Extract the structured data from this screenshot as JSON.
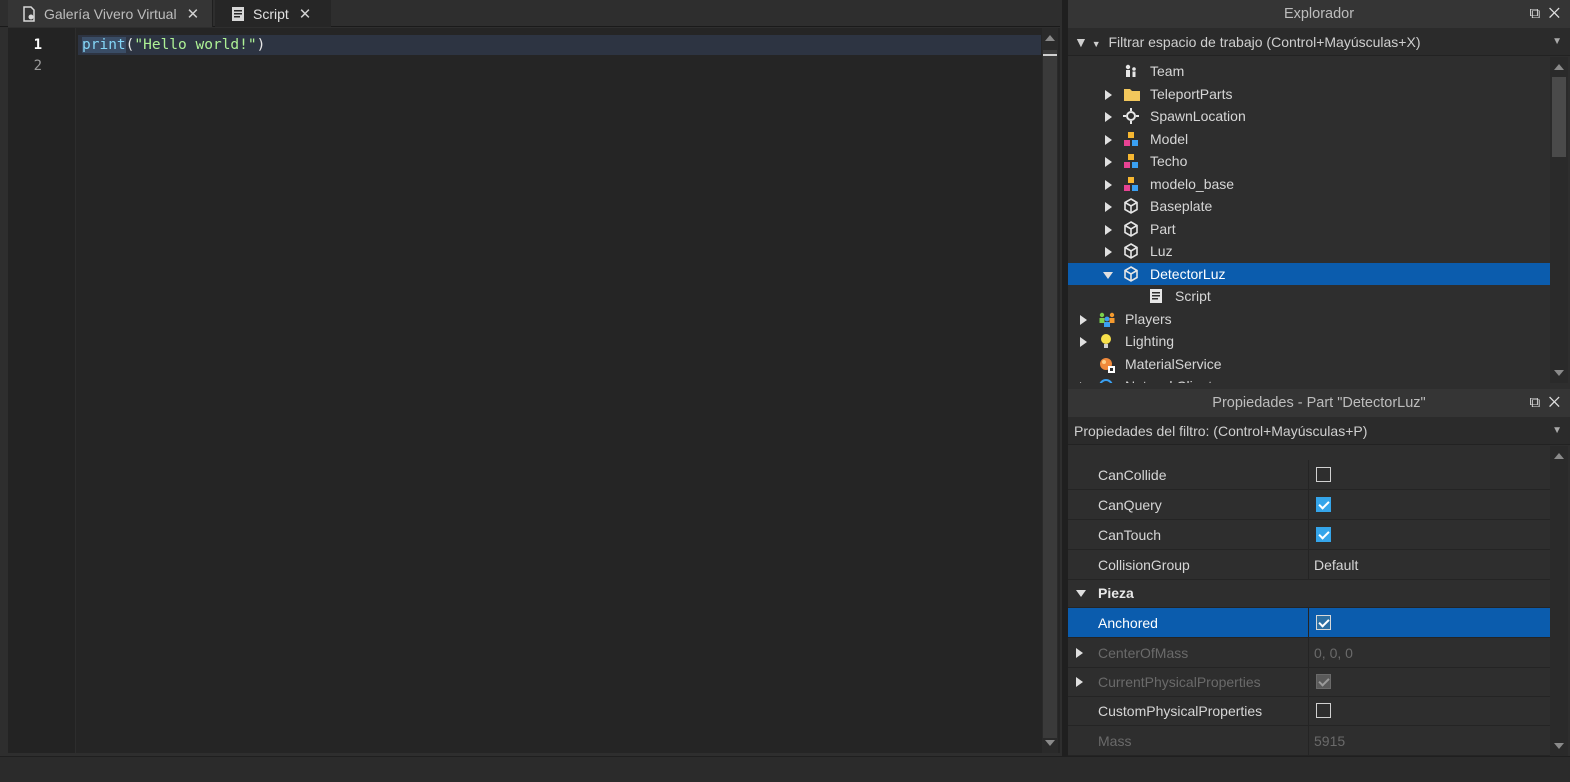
{
  "tabs": [
    {
      "label": "Galería Vivero Virtual",
      "icon": "script-tab-icon"
    },
    {
      "label": "Script",
      "icon": "script-icon"
    }
  ],
  "editor": {
    "line_numbers": [
      "1",
      "2"
    ],
    "code": {
      "fn": "print",
      "open": "(",
      "string": "\"Hello world!\"",
      "close": ")"
    }
  },
  "explorer": {
    "title": "Explorador",
    "filter_placeholder": "Filtrar espacio de trabajo (Control+Mayúsculas+X)",
    "items": [
      {
        "label": "Team",
        "icon": "team-icon",
        "expandable": false
      },
      {
        "label": "TeleportParts",
        "icon": "folder-icon",
        "expandable": true
      },
      {
        "label": "SpawnLocation",
        "icon": "spawn-icon",
        "expandable": true
      },
      {
        "label": "Model",
        "icon": "model-icon",
        "expandable": true
      },
      {
        "label": "Techo",
        "icon": "model-icon",
        "expandable": true
      },
      {
        "label": "modelo_base",
        "icon": "model-icon",
        "expandable": true
      },
      {
        "label": "Baseplate",
        "icon": "part-icon",
        "expandable": true
      },
      {
        "label": "Part",
        "icon": "part-icon",
        "expandable": true
      },
      {
        "label": "Luz",
        "icon": "part-icon",
        "expandable": true
      },
      {
        "label": "DetectorLuz",
        "icon": "part-icon",
        "expandable": true,
        "expanded": true,
        "selected": true
      },
      {
        "label": "Script",
        "icon": "script-icon",
        "expandable": false
      },
      {
        "label": "Players",
        "icon": "players-icon",
        "expandable": true
      },
      {
        "label": "Lighting",
        "icon": "lighting-icon",
        "expandable": true
      },
      {
        "label": "MaterialService",
        "icon": "material-service-icon",
        "expandable": false
      },
      {
        "label": "NetworkClient",
        "icon": "network-icon",
        "expandable": true
      }
    ]
  },
  "properties": {
    "title": "Propiedades - Part \"DetectorLuz\"",
    "filter_placeholder": "Propiedades del filtro: (Control+Mayúsculas+P)",
    "rows": [
      {
        "name": "CanCollide",
        "type": "checkbox",
        "checked": false
      },
      {
        "name": "CanQuery",
        "type": "checkbox",
        "checked": true
      },
      {
        "name": "CanTouch",
        "type": "checkbox",
        "checked": true
      },
      {
        "name": "CollisionGroup",
        "type": "text",
        "value": "Default"
      },
      {
        "name": "Pieza",
        "type": "category"
      },
      {
        "name": "Anchored",
        "type": "checkbox",
        "checked": true,
        "selected": true
      },
      {
        "name": "CenterOfMass",
        "type": "text",
        "value": "0, 0, 0",
        "disabled": true,
        "expandable": true
      },
      {
        "name": "CurrentPhysicalProperties",
        "type": "checkbox",
        "checked": true,
        "disabled": true,
        "expandable": true
      },
      {
        "name": "CustomPhysicalProperties",
        "type": "checkbox",
        "checked": false
      },
      {
        "name": "Mass",
        "type": "text",
        "value": "5915",
        "disabled": true
      }
    ]
  },
  "colors": {
    "selection": "#0b5cad",
    "checkbox_on": "#35a5ea"
  }
}
